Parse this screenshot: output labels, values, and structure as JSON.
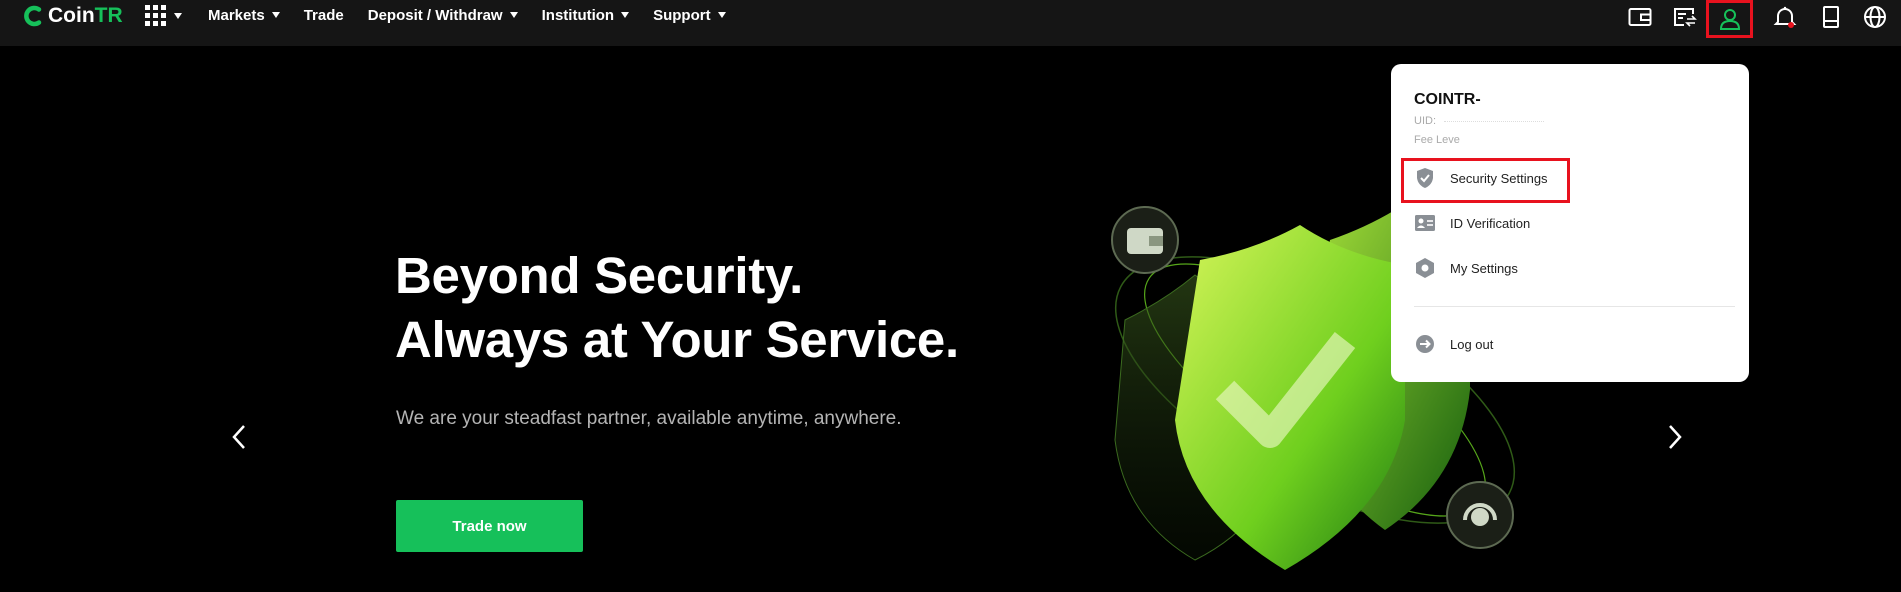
{
  "brand": {
    "name_a": "Coin",
    "name_b": "TR"
  },
  "nav": {
    "items": [
      {
        "label": "Markets",
        "has_caret": true
      },
      {
        "label": "Trade",
        "has_caret": false
      },
      {
        "label": "Deposit / Withdraw",
        "has_caret": true
      },
      {
        "label": "Institution",
        "has_caret": true
      },
      {
        "label": "Support",
        "has_caret": true
      }
    ],
    "right_icons": [
      "wallet-icon",
      "orders-icon",
      "user-icon",
      "bell-icon",
      "download-icon",
      "globe-icon"
    ]
  },
  "hero": {
    "title_line1": "Beyond Security.",
    "title_line2": "Always at Your Service.",
    "subtitle": "We are your steadfast partner, available anytime, anywhere.",
    "cta_label": "Trade now"
  },
  "dropdown": {
    "name": "COINTR-",
    "uid_label": "UID:",
    "fee_label": "Fee Leve",
    "items": [
      {
        "label": "Security Settings",
        "icon": "shield-check-icon"
      },
      {
        "label": "ID Verification",
        "icon": "id-card-icon"
      },
      {
        "label": "My Settings",
        "icon": "settings-hex-icon"
      }
    ],
    "logout_label": "Log out"
  },
  "colors": {
    "accent": "#16c05a",
    "highlight": "#e8121e",
    "nav_bg": "#151515",
    "page_bg": "#000000"
  }
}
